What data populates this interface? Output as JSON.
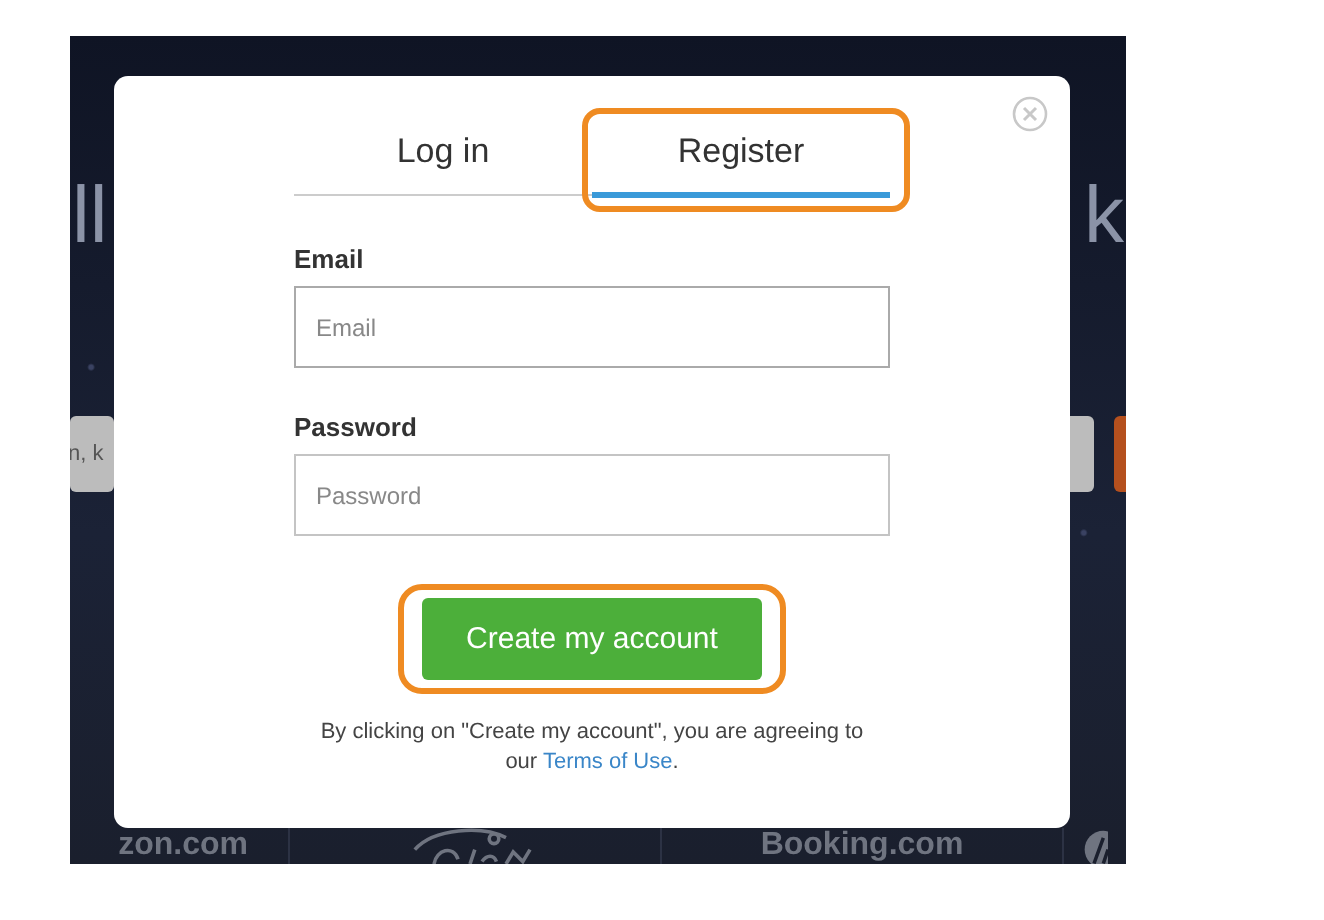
{
  "background": {
    "headline_left": "ll",
    "headline_right": "k",
    "search_text": "n, k",
    "logos": [
      {
        "kind": "text",
        "label": "zon.com"
      },
      {
        "kind": "script"
      },
      {
        "kind": "text",
        "label": "Booking.com"
      },
      {
        "kind": "round"
      }
    ]
  },
  "dialog": {
    "tabs": [
      {
        "label": "Log in",
        "selected": false,
        "highlighted": false
      },
      {
        "label": "Register",
        "selected": true,
        "highlighted": true
      }
    ],
    "fields": [
      {
        "label": "Email",
        "placeholder": "Email",
        "focused": true
      },
      {
        "label": "Password",
        "placeholder": "Password",
        "focused": false
      }
    ],
    "submit": {
      "label": "Create my account",
      "highlighted": true
    },
    "agreement": {
      "text": "By clicking on \"Create my account\", you are agreeing to",
      "link_prefix": "our",
      "link": "Terms of Use",
      "suffix": "."
    }
  }
}
